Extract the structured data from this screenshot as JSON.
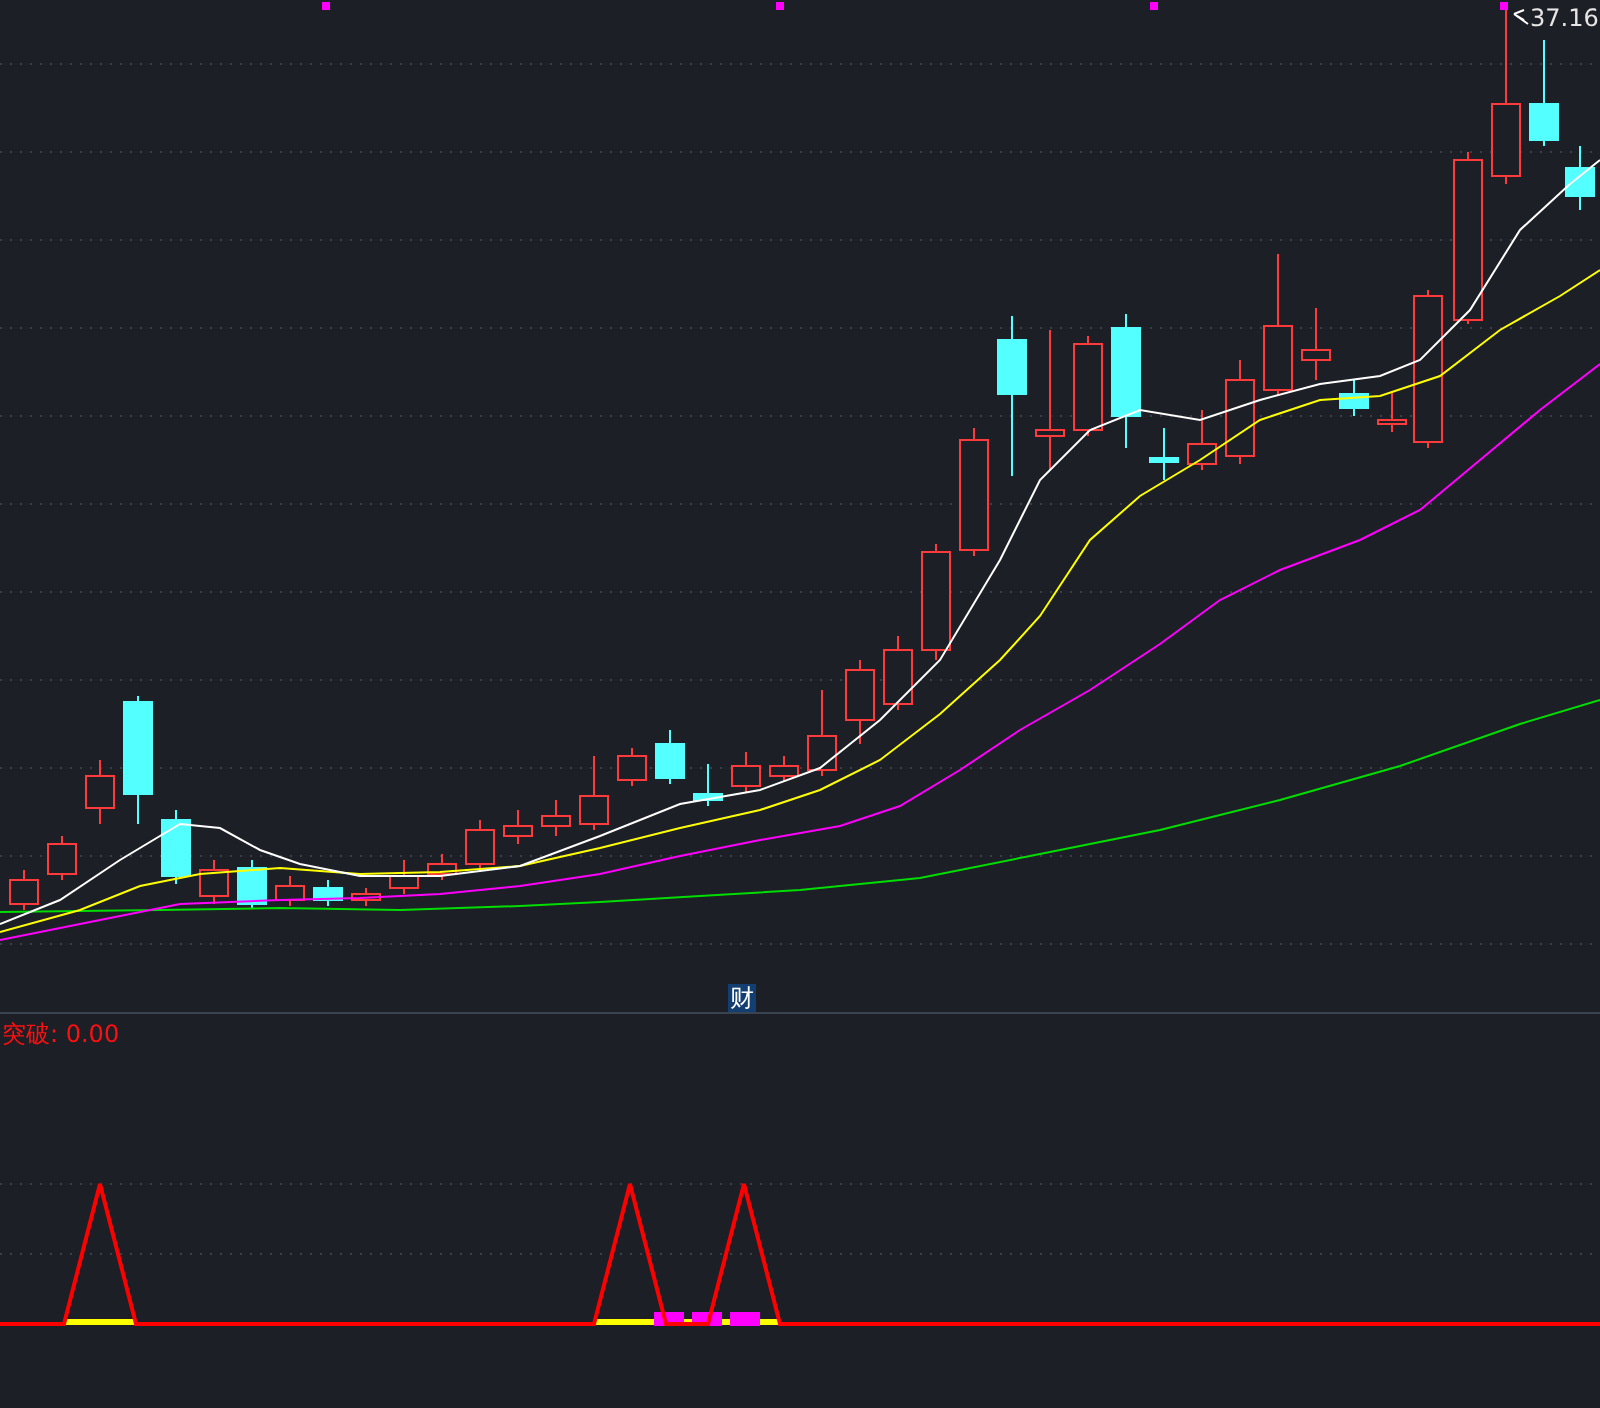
{
  "price_chart": {
    "high_price_label": "37.16",
    "event_marker": "财"
  },
  "indicator": {
    "title": "突破: 0.00"
  }
}
